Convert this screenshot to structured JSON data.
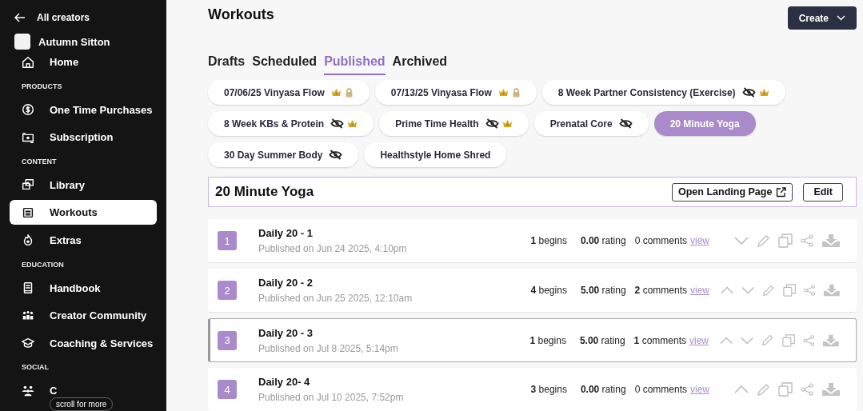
{
  "sidebar": {
    "back_link": "All creators",
    "creator": "Autumn Sitton",
    "items": [
      {
        "kind": "link",
        "label": "Home",
        "selected": false
      },
      {
        "kind": "heading",
        "label": "PRODUCTS"
      },
      {
        "kind": "link",
        "label": "One Time Purchases",
        "selected": false
      },
      {
        "kind": "link",
        "label": "Subscription",
        "selected": false
      },
      {
        "kind": "heading",
        "label": "CONTENT"
      },
      {
        "kind": "link",
        "label": "Library",
        "selected": false
      },
      {
        "kind": "link",
        "label": "Workouts",
        "selected": true
      },
      {
        "kind": "link",
        "label": "Extras",
        "selected": false
      },
      {
        "kind": "heading",
        "label": "EDUCATION"
      },
      {
        "kind": "link",
        "label": "Handbook",
        "selected": false
      },
      {
        "kind": "link",
        "label": "Creator Community",
        "selected": false
      },
      {
        "kind": "link",
        "label": "Coaching & Services",
        "selected": false
      },
      {
        "kind": "heading",
        "label": "SOCIAL"
      },
      {
        "kind": "link",
        "label": "C",
        "selected": false
      }
    ],
    "scroll_hint": "scroll for more"
  },
  "page": {
    "title": "Workouts",
    "create_button": "Create",
    "tabs": [
      {
        "label": "Drafts",
        "selected": false
      },
      {
        "label": "Scheduled",
        "selected": false
      },
      {
        "label": "Published",
        "selected": true
      },
      {
        "label": "Archived",
        "selected": false
      }
    ],
    "programs": [
      {
        "label": "07/06/25 Vinyasa Flow",
        "hidden": false,
        "premium": true,
        "locked": true,
        "selected": false
      },
      {
        "label": "07/13/25 Vinyasa Flow",
        "hidden": false,
        "premium": true,
        "locked": true,
        "selected": false
      },
      {
        "label": "8 Week Partner Consistency (Exercise)",
        "hidden": true,
        "premium": true,
        "locked": false,
        "selected": false
      },
      {
        "label": "8 Week KBs & Protein",
        "hidden": true,
        "premium": true,
        "locked": false,
        "selected": false
      },
      {
        "label": "Prime Time Health",
        "hidden": true,
        "premium": true,
        "locked": false,
        "selected": false
      },
      {
        "label": "Prenatal Core",
        "hidden": true,
        "premium": false,
        "locked": false,
        "selected": false
      },
      {
        "label": "20 Minute Yoga",
        "hidden": false,
        "premium": false,
        "locked": false,
        "selected": true
      },
      {
        "label": "30 Day Summer Body",
        "hidden": true,
        "premium": false,
        "locked": false,
        "selected": false
      },
      {
        "label": "Healthstyle Home Shred",
        "hidden": false,
        "premium": false,
        "locked": false,
        "selected": false
      }
    ],
    "program_header": {
      "title": "20 Minute Yoga",
      "landing_button": "Open Landing Page",
      "edit_button": "Edit"
    },
    "workouts": [
      {
        "number": "1",
        "title": "Daily 20 - 1",
        "date": "Published on Jun 24 2025, 4:10pm",
        "begins": "**1** begins",
        "rating": "**0.00** rating",
        "comments": "0 comments",
        "view_link": "view",
        "can_move_up": false,
        "can_move_down": true,
        "selected": false
      },
      {
        "number": "2",
        "title": "Daily 20 - 2",
        "date": "Published on Jun 25 2025, 12:10am",
        "begins": "**4** begins",
        "rating": "**5.00** rating",
        "comments": "**2** comments",
        "view_link": "view",
        "can_move_up": true,
        "can_move_down": true,
        "selected": false
      },
      {
        "number": "3",
        "title": "Daily 20 - 3",
        "date": "Published on Jul 8 2025, 5:14pm",
        "begins": "**1** begins",
        "rating": "**5.00** rating",
        "comments": "**1** comments",
        "view_link": "view",
        "can_move_up": true,
        "can_move_down": true,
        "selected": true
      },
      {
        "number": "4",
        "title": "Daily 20- 4",
        "date": "Published on Jul 10 2025, 7:52pm",
        "begins": "**3** begins",
        "rating": "**0.00** rating",
        "comments": "0 comments",
        "view_link": "view",
        "can_move_up": true,
        "can_move_down": false,
        "selected": false
      }
    ]
  }
}
